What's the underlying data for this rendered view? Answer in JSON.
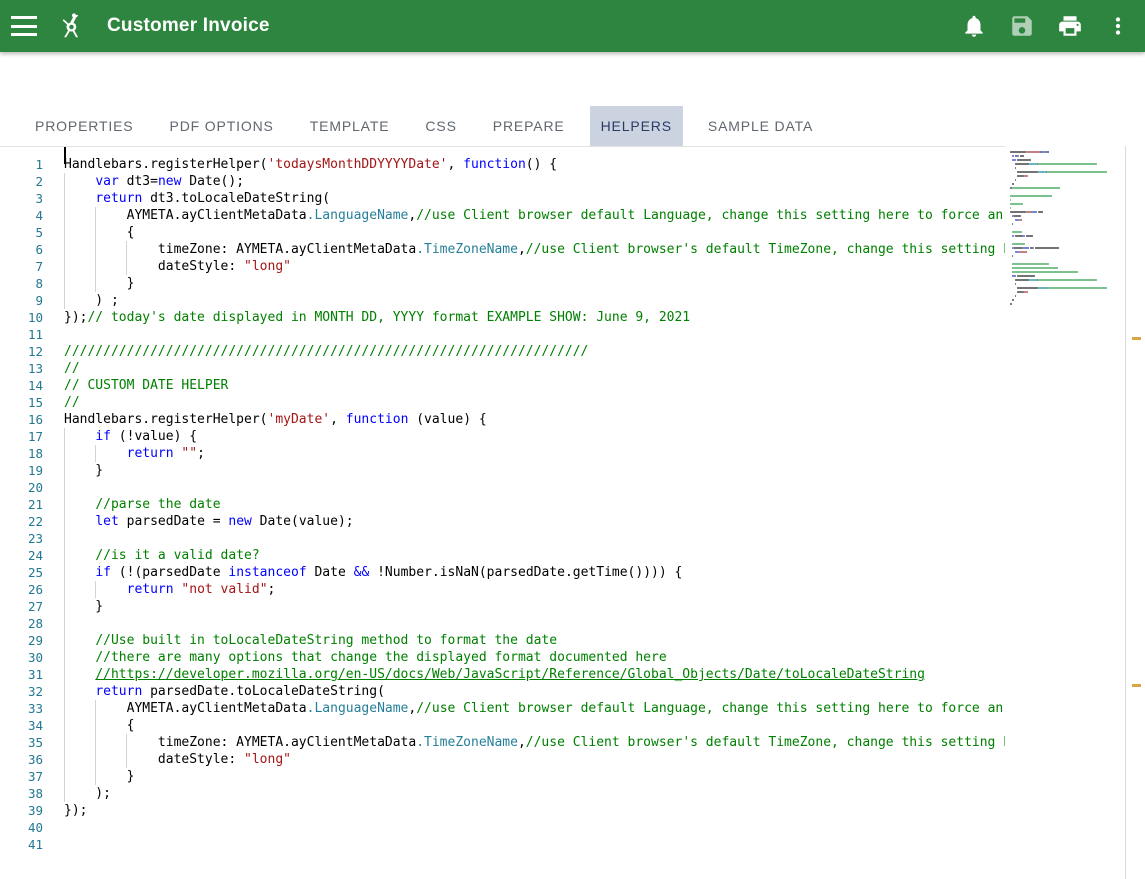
{
  "appbar": {
    "menu_icon": "hamburger-menu-icon",
    "logo_icon": "compass-logo-icon",
    "title": "Customer Invoice",
    "actions": [
      {
        "name": "notifications-icon",
        "label": "Notifications",
        "icon": "bell-icon",
        "disabled": false
      },
      {
        "name": "save-icon",
        "label": "Save",
        "icon": "floppy-disk-icon",
        "disabled": true
      },
      {
        "name": "print-icon",
        "label": "Print",
        "icon": "printer-icon",
        "disabled": false
      },
      {
        "name": "more-icon",
        "label": "More options",
        "icon": "kebab-menu-icon",
        "disabled": false
      }
    ],
    "background_color": "#2e8540",
    "text_color": "#ffffff"
  },
  "tabs": {
    "items": [
      {
        "label": "PROPERTIES",
        "active": false
      },
      {
        "label": "PDF OPTIONS",
        "active": false
      },
      {
        "label": "TEMPLATE",
        "active": false
      },
      {
        "label": "CSS",
        "active": false
      },
      {
        "label": "PREPARE",
        "active": false
      },
      {
        "label": "HELPERS",
        "active": true
      },
      {
        "label": "SAMPLE DATA",
        "active": false
      }
    ],
    "active_background": "#ccd3e0",
    "active_text_color": "#2b3a67",
    "inactive_text_color": "#60676f"
  },
  "editor": {
    "language": "javascript",
    "line_number_color": "#237893",
    "first_line_number": 1,
    "last_line_number": 41,
    "total_lines": 41,
    "cursor_line": 1,
    "cursor_column": 1,
    "lines": [
      {
        "n": 1,
        "indent": 0,
        "tokens": [
          {
            "t": "Handlebars.registerHelper(",
            "c": "plain"
          },
          {
            "t": "'todaysMonthDDYYYYDate'",
            "c": "str"
          },
          {
            "t": ", ",
            "c": "plain"
          },
          {
            "t": "function",
            "c": "kw"
          },
          {
            "t": "() {",
            "c": "plain"
          }
        ]
      },
      {
        "n": 2,
        "indent": 1,
        "tokens": [
          {
            "t": "    ",
            "c": "plain"
          },
          {
            "t": "var",
            "c": "kw"
          },
          {
            "t": " dt3=",
            "c": "plain"
          },
          {
            "t": "new",
            "c": "kw"
          },
          {
            "t": " Date();",
            "c": "plain"
          }
        ]
      },
      {
        "n": 3,
        "indent": 1,
        "tokens": [
          {
            "t": "    ",
            "c": "plain"
          },
          {
            "t": "return",
            "c": "kw"
          },
          {
            "t": " dt3.toLocaleDateString(",
            "c": "plain"
          }
        ]
      },
      {
        "n": 4,
        "indent": 2,
        "tokens": [
          {
            "t": "        AYMETA.ayClientMetaData",
            "c": "plain"
          },
          {
            "t": ".LanguageName",
            "c": "prop"
          },
          {
            "t": ",",
            "c": "plain"
          },
          {
            "t": "//use Client browser default Language, change this setting here to force an alternative language",
            "c": "cmt"
          }
        ]
      },
      {
        "n": 5,
        "indent": 2,
        "tokens": [
          {
            "t": "        {",
            "c": "plain"
          }
        ]
      },
      {
        "n": 6,
        "indent": 3,
        "tokens": [
          {
            "t": "            timeZone: AYMETA.ayClientMetaData",
            "c": "plain"
          },
          {
            "t": ".TimeZoneName",
            "c": "prop"
          },
          {
            "t": ",",
            "c": "plain"
          },
          {
            "t": "//use Client browser's default TimeZone, change this setting here to force an alternative TimeZone",
            "c": "cmt"
          }
        ]
      },
      {
        "n": 7,
        "indent": 3,
        "tokens": [
          {
            "t": "            dateStyle: ",
            "c": "plain"
          },
          {
            "t": "\"long\"",
            "c": "str"
          }
        ]
      },
      {
        "n": 8,
        "indent": 2,
        "tokens": [
          {
            "t": "        }",
            "c": "plain"
          }
        ]
      },
      {
        "n": 9,
        "indent": 1,
        "tokens": [
          {
            "t": "    ) ;",
            "c": "plain"
          }
        ]
      },
      {
        "n": 10,
        "indent": 0,
        "tokens": [
          {
            "t": "});",
            "c": "plain"
          },
          {
            "t": "// today's date displayed in MONTH DD, YYYY format EXAMPLE SHOW: June 9, 2021",
            "c": "cmt"
          }
        ]
      },
      {
        "n": 11,
        "indent": 0,
        "tokens": []
      },
      {
        "n": 12,
        "indent": 0,
        "tokens": [
          {
            "t": "///////////////////////////////////////////////////////////////////",
            "c": "cmt"
          }
        ]
      },
      {
        "n": 13,
        "indent": 0,
        "tokens": [
          {
            "t": "//",
            "c": "cmt"
          }
        ]
      },
      {
        "n": 14,
        "indent": 0,
        "tokens": [
          {
            "t": "// CUSTOM DATE HELPER",
            "c": "cmt"
          }
        ]
      },
      {
        "n": 15,
        "indent": 0,
        "tokens": [
          {
            "t": "//",
            "c": "cmt"
          }
        ]
      },
      {
        "n": 16,
        "indent": 0,
        "tokens": [
          {
            "t": "Handlebars.registerHelper(",
            "c": "plain"
          },
          {
            "t": "'myDate'",
            "c": "str"
          },
          {
            "t": ", ",
            "c": "plain"
          },
          {
            "t": "function",
            "c": "kw"
          },
          {
            "t": " (value) {",
            "c": "plain"
          }
        ]
      },
      {
        "n": 17,
        "indent": 1,
        "tokens": [
          {
            "t": "    ",
            "c": "plain"
          },
          {
            "t": "if",
            "c": "kw"
          },
          {
            "t": " (!value) {",
            "c": "plain"
          }
        ]
      },
      {
        "n": 18,
        "indent": 2,
        "tokens": [
          {
            "t": "        ",
            "c": "plain"
          },
          {
            "t": "return",
            "c": "kw"
          },
          {
            "t": " ",
            "c": "plain"
          },
          {
            "t": "\"\"",
            "c": "str"
          },
          {
            "t": ";",
            "c": "plain"
          }
        ]
      },
      {
        "n": 19,
        "indent": 1,
        "tokens": [
          {
            "t": "    }",
            "c": "plain"
          }
        ]
      },
      {
        "n": 20,
        "indent": 1,
        "tokens": []
      },
      {
        "n": 21,
        "indent": 1,
        "tokens": [
          {
            "t": "    ",
            "c": "plain"
          },
          {
            "t": "//parse the date",
            "c": "cmt"
          }
        ]
      },
      {
        "n": 22,
        "indent": 1,
        "tokens": [
          {
            "t": "    ",
            "c": "plain"
          },
          {
            "t": "let",
            "c": "kw"
          },
          {
            "t": " parsedDate = ",
            "c": "plain"
          },
          {
            "t": "new",
            "c": "kw"
          },
          {
            "t": " Date(value);",
            "c": "plain"
          }
        ]
      },
      {
        "n": 23,
        "indent": 1,
        "tokens": []
      },
      {
        "n": 24,
        "indent": 1,
        "tokens": [
          {
            "t": "    ",
            "c": "plain"
          },
          {
            "t": "//is it a valid date?",
            "c": "cmt"
          }
        ]
      },
      {
        "n": 25,
        "indent": 1,
        "tokens": [
          {
            "t": "    ",
            "c": "plain"
          },
          {
            "t": "if",
            "c": "kw"
          },
          {
            "t": " (!(parsedDate ",
            "c": "plain"
          },
          {
            "t": "instanceof",
            "c": "kw"
          },
          {
            "t": " Date ",
            "c": "plain"
          },
          {
            "t": "&&",
            "c": "kw"
          },
          {
            "t": " !Number.isNaN(parsedDate.getTime()))) {",
            "c": "plain"
          }
        ]
      },
      {
        "n": 26,
        "indent": 2,
        "tokens": [
          {
            "t": "        ",
            "c": "plain"
          },
          {
            "t": "return",
            "c": "kw"
          },
          {
            "t": " ",
            "c": "plain"
          },
          {
            "t": "\"not valid\"",
            "c": "str"
          },
          {
            "t": ";",
            "c": "plain"
          }
        ]
      },
      {
        "n": 27,
        "indent": 1,
        "tokens": [
          {
            "t": "    }",
            "c": "plain"
          }
        ]
      },
      {
        "n": 28,
        "indent": 1,
        "tokens": []
      },
      {
        "n": 29,
        "indent": 1,
        "tokens": [
          {
            "t": "    ",
            "c": "plain"
          },
          {
            "t": "//Use built in toLocaleDateString method to format the date",
            "c": "cmt"
          }
        ]
      },
      {
        "n": 30,
        "indent": 1,
        "tokens": [
          {
            "t": "    ",
            "c": "plain"
          },
          {
            "t": "//there are many options that change the displayed format documented here",
            "c": "cmt"
          }
        ]
      },
      {
        "n": 31,
        "indent": 1,
        "tokens": [
          {
            "t": "    ",
            "c": "plain"
          },
          {
            "t": "//https://developer.mozilla.org/en-US/docs/Web/JavaScript/Reference/Global_Objects/Date/toLocaleDateString",
            "c": "link"
          }
        ]
      },
      {
        "n": 32,
        "indent": 1,
        "tokens": [
          {
            "t": "    ",
            "c": "plain"
          },
          {
            "t": "return",
            "c": "kw"
          },
          {
            "t": " parsedDate.toLocaleDateString(",
            "c": "plain"
          }
        ]
      },
      {
        "n": 33,
        "indent": 2,
        "tokens": [
          {
            "t": "        AYMETA.ayClientMetaData",
            "c": "plain"
          },
          {
            "t": ".LanguageName",
            "c": "prop"
          },
          {
            "t": ",",
            "c": "plain"
          },
          {
            "t": "//use Client browser default Language, change this setting here to force an alternative language",
            "c": "cmt"
          }
        ]
      },
      {
        "n": 34,
        "indent": 2,
        "tokens": [
          {
            "t": "        {",
            "c": "plain"
          }
        ]
      },
      {
        "n": 35,
        "indent": 3,
        "tokens": [
          {
            "t": "            timeZone: AYMETA.ayClientMetaData",
            "c": "plain"
          },
          {
            "t": ".TimeZoneName",
            "c": "prop"
          },
          {
            "t": ",",
            "c": "plain"
          },
          {
            "t": "//use Client browser's default TimeZone, change this setting here to force an alternative TimeZone",
            "c": "cmt"
          }
        ]
      },
      {
        "n": 36,
        "indent": 3,
        "tokens": [
          {
            "t": "            dateStyle: ",
            "c": "plain"
          },
          {
            "t": "\"long\"",
            "c": "str"
          }
        ]
      },
      {
        "n": 37,
        "indent": 2,
        "tokens": [
          {
            "t": "        }",
            "c": "plain"
          }
        ]
      },
      {
        "n": 38,
        "indent": 1,
        "tokens": [
          {
            "t": "    );",
            "c": "plain"
          }
        ]
      },
      {
        "n": 39,
        "indent": 0,
        "tokens": [
          {
            "t": "});",
            "c": "plain"
          }
        ]
      },
      {
        "n": 40,
        "indent": 0,
        "tokens": []
      },
      {
        "n": 41,
        "indent": 0,
        "tokens": []
      }
    ]
  },
  "minimap": {
    "name": "code-minimap",
    "visible": true
  },
  "colors": {
    "keyword": "#0000ff",
    "string": "#a31515",
    "comment": "#008000",
    "property": "#267f99",
    "line_number": "#237893",
    "plain": "#000000",
    "header_green": "#2e8540",
    "active_tab": "#ccd3e0"
  }
}
